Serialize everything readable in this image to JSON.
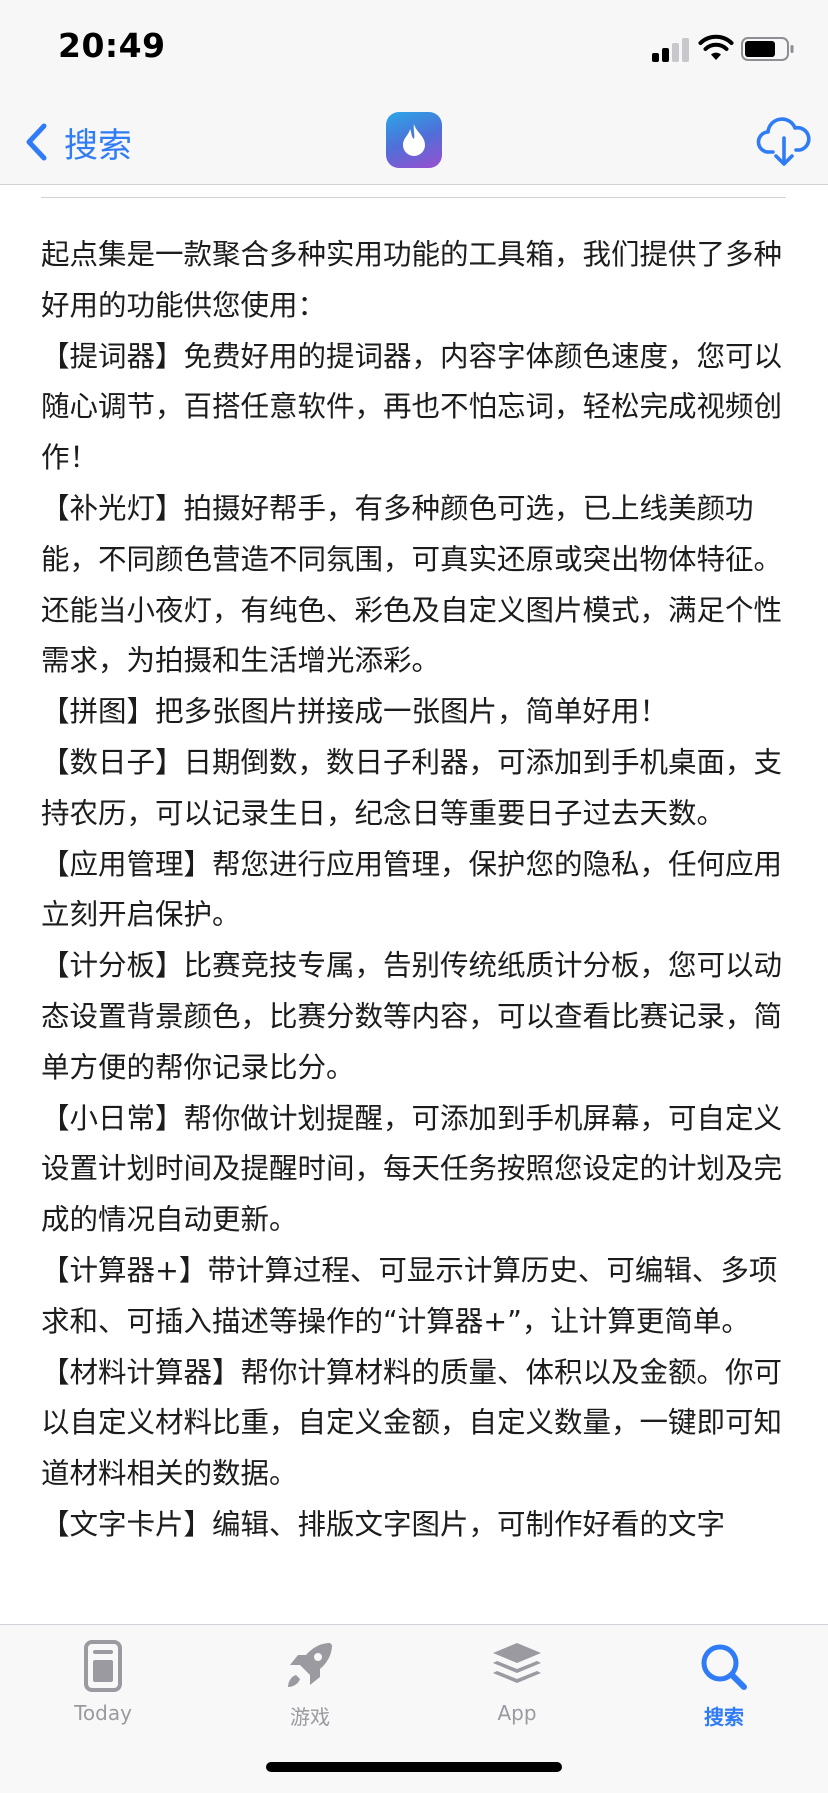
{
  "status_bar": {
    "time": "20:49"
  },
  "nav": {
    "back_label": "搜索"
  },
  "description": [
    "起点集是一款聚合多种实用功能的工具箱，我们提供了多种好用的功能供您使用：",
    "【提词器】免费好用的提词器，内容字体颜色速度，您可以随心调节，百搭任意软件，再也不怕忘词，轻松完成视频创作！",
    "【补光灯】拍摄好帮手，有多种颜色可选，已上线美颜功能，不同颜色营造不同氛围，可真实还原或突出物体特征。还能当小夜灯，有纯色、彩色及自定义图片模式，满足个性需求，为拍摄和生活增光添彩。",
    "【拼图】把多张图片拼接成一张图片，简单好用！",
    "【数日子】日期倒数，数日子利器，可添加到手机桌面，支持农历，可以记录生日，纪念日等重要日子过去天数。",
    "【应用管理】帮您进行应用管理，保护您的隐私，任何应用立刻开启保护。",
    "【计分板】比赛竞技专属，告别传统纸质计分板，您可以动态设置背景颜色，比赛分数等内容，可以查看比赛记录，简单方便的帮你记录比分。",
    "【小日常】帮你做计划提醒，可添加到手机屏幕，可自定义设置计划时间及提醒时间，每天任务按照您设定的计划及完成的情况自动更新。",
    "【计算器+】带计算过程、可显示计算历史、可编辑、多项求和、可插入描述等操作的“计算器+”，让计算更简单。",
    "【材料计算器】帮你计算材料的质量、体积以及金额。你可以自定义材料比重，自定义金额，自定义数量，一键即可知道材料相关的数据。",
    "【文字卡片】编辑、排版文字图片，可制作好看的文字"
  ],
  "tab_bar": {
    "today": "Today",
    "games": "游戏",
    "apps": "App",
    "search": "搜索"
  },
  "colors": {
    "accent": "#2f7cf6",
    "inactive": "#9a9aa0",
    "text": "#1c1c1e"
  },
  "icons": [
    "signal-icon",
    "wifi-icon",
    "battery-icon",
    "chevron-left-icon",
    "app-flame-icon",
    "cloud-download-icon",
    "today-icon",
    "rocket-icon",
    "layers-icon",
    "search-icon"
  ]
}
